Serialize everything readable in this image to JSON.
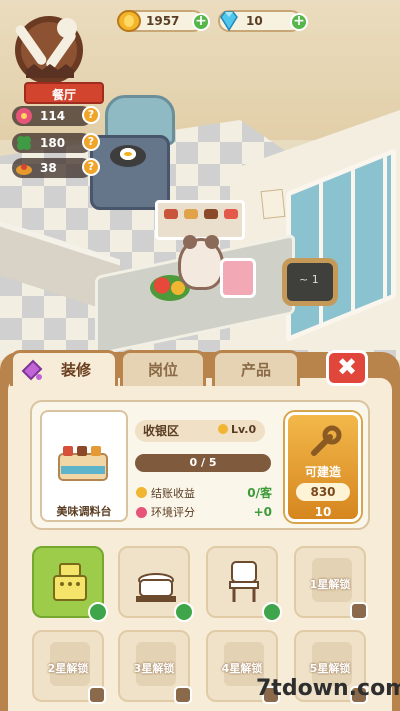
{
  "hud": {
    "gold": "1957",
    "gems": "10",
    "gold_icon": "gold-coin-icon",
    "gem_icon": "diamond-icon"
  },
  "badge": {
    "label": "餐厅",
    "icon": "fork-spoon-icon"
  },
  "stats": [
    {
      "icon": "flower-icon",
      "value": "114"
    },
    {
      "icon": "clover-icon",
      "value": "180"
    },
    {
      "icon": "food-icon",
      "value": "38"
    }
  ],
  "tabs": [
    {
      "label": "装修",
      "active": true
    },
    {
      "label": "岗位",
      "active": false
    },
    {
      "label": "产品",
      "active": false
    }
  ],
  "close_label": "✖",
  "detail": {
    "item_name": "美味调料台",
    "zone": "收银区",
    "level": "Lv.0",
    "progress_text": "0 / 5",
    "progress": 0,
    "checkout_label": "结账收益",
    "checkout_value": "0/客",
    "env_label": "环境评分",
    "env_value": "+0",
    "build_label": "可建造",
    "build_cost": "830",
    "build_bonus": "10"
  },
  "slots": [
    {
      "type": "cash-register-icon",
      "selected": true,
      "locked": false,
      "label": ""
    },
    {
      "type": "cooking-pot-icon",
      "selected": false,
      "locked": false,
      "label": ""
    },
    {
      "type": "chair-icon",
      "selected": false,
      "locked": false,
      "label": ""
    },
    {
      "type": "jar-icon",
      "selected": false,
      "locked": true,
      "label": "1星解锁"
    },
    {
      "type": "lock",
      "selected": false,
      "locked": true,
      "label": "2星解锁"
    },
    {
      "type": "lock",
      "selected": false,
      "locked": true,
      "label": "3星解锁"
    },
    {
      "type": "lock",
      "selected": false,
      "locked": true,
      "label": "4星解锁"
    },
    {
      "type": "lock",
      "selected": false,
      "locked": true,
      "label": "5星解锁"
    }
  ],
  "watermark": "7tdown.com"
}
